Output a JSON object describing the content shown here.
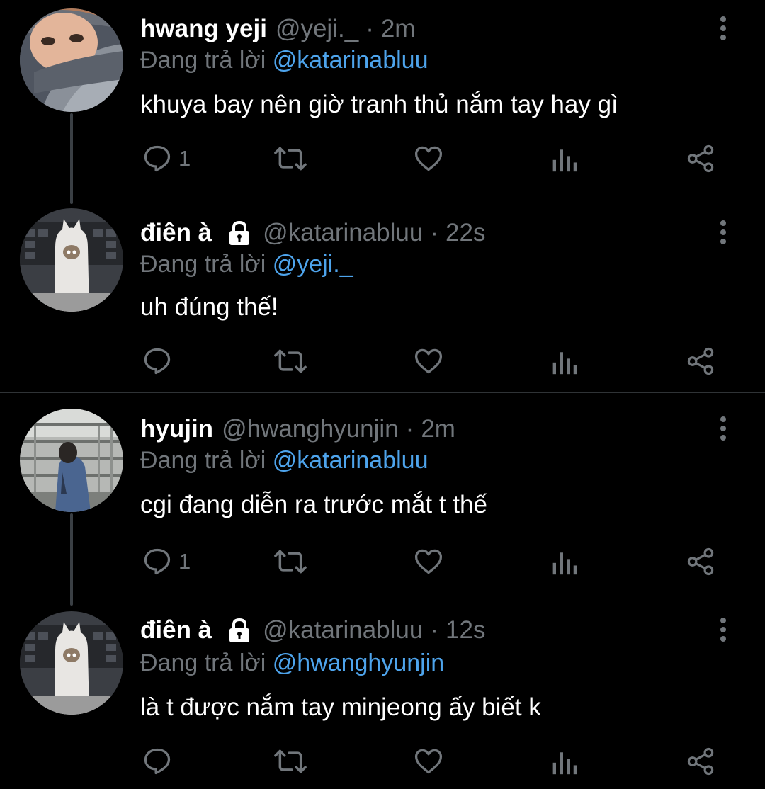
{
  "labels": {
    "replying_to": "Đang trả lời"
  },
  "colors": {
    "background": "#000000",
    "text_primary": "#ffffff",
    "text_secondary": "#71767b",
    "mention": "#4ea4ec",
    "divider": "#2f3336"
  },
  "threads": [
    {
      "tweets": [
        {
          "avatar": "yeji-avatar",
          "name": "hwang yeji",
          "protected": false,
          "handle": "@yeji._",
          "separator": "·",
          "time": "2m",
          "replying_to": "@katarinabluu",
          "text": "khuya bay nên giờ tranh thủ nắm tay hay gì",
          "reply_count": "1"
        },
        {
          "avatar": "ghost-avatar",
          "name": "điên à",
          "protected": true,
          "handle": "@katarinabluu",
          "separator": "·",
          "time": "22s",
          "replying_to": "@yeji._",
          "text": "uh đúng thế!",
          "reply_count": ""
        }
      ]
    },
    {
      "tweets": [
        {
          "avatar": "hyujin-avatar",
          "name": "hyujin",
          "protected": false,
          "handle": "@hwanghyunjin",
          "separator": "·",
          "time": "2m",
          "replying_to": "@katarinabluu",
          "text": "cgi đang diễn ra trước mắt t thế",
          "reply_count": "1"
        },
        {
          "avatar": "ghost-avatar",
          "name": "điên à",
          "protected": true,
          "handle": "@katarinabluu",
          "separator": "·",
          "time": "12s",
          "replying_to": "@hwanghyunjin",
          "text": "là t được nắm tay minjeong ấy biết k",
          "reply_count": ""
        }
      ]
    }
  ],
  "icons": {
    "reply": "reply-icon",
    "retweet": "retweet-icon",
    "like": "heart-icon",
    "views": "analytics-icon",
    "share": "share-icon",
    "more": "more-vertical-icon",
    "lock": "lock-icon"
  }
}
